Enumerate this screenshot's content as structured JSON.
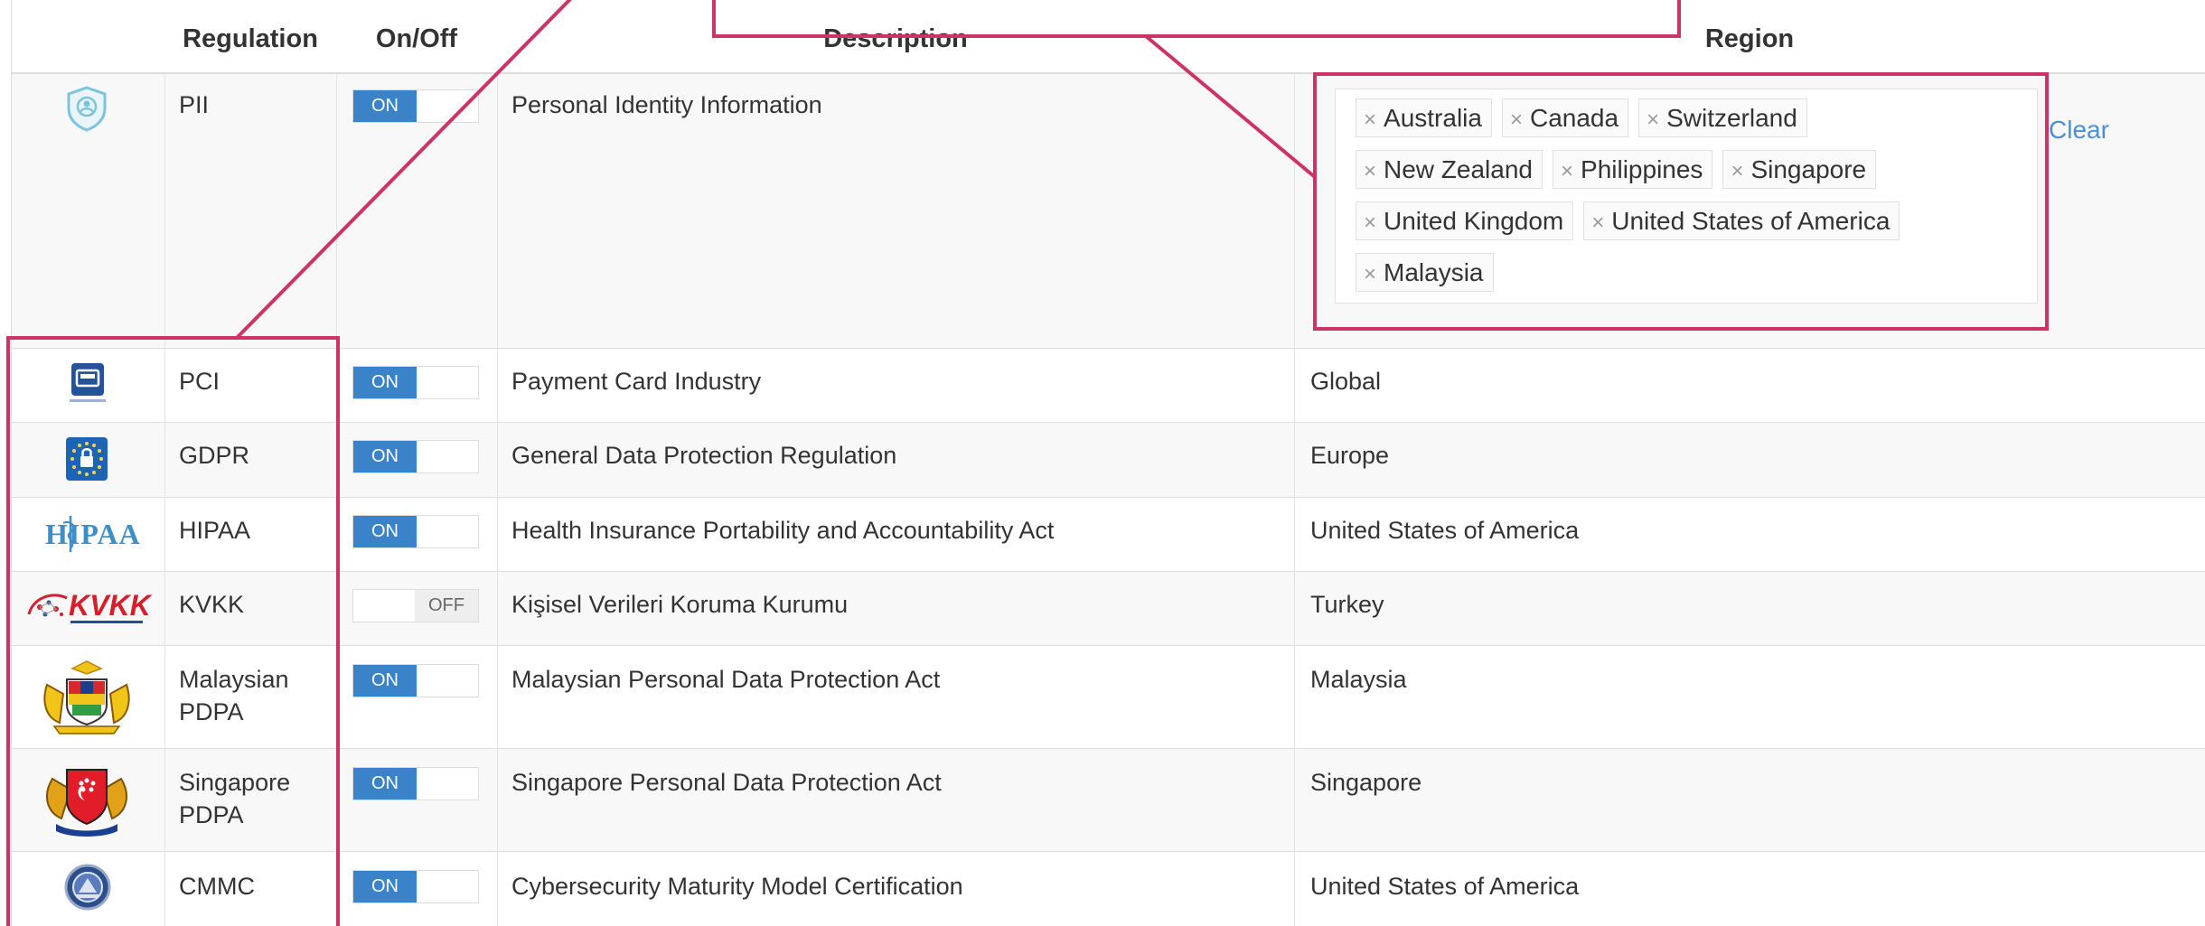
{
  "header": {
    "regulation": "Regulation",
    "onoff": "On/Off",
    "description": "Description",
    "region": "Region"
  },
  "rows": [
    {
      "name": "PII",
      "toggle": "ON",
      "description": "Personal Identity Information",
      "icon": "shield-user-icon"
    },
    {
      "name": "PCI",
      "toggle": "ON",
      "description": "Payment Card Industry",
      "region": "Global",
      "icon": "pci-compliance-icon"
    },
    {
      "name": "GDPR",
      "toggle": "ON",
      "description": "General Data Protection Regulation",
      "region": "Europe",
      "icon": "eu-lock-icon"
    },
    {
      "name": "HIPAA",
      "toggle": "ON",
      "description": "Health Insurance Portability and Accountability Act",
      "region": "United States of America",
      "icon": "hipaa-logo-icon",
      "logo_text": "HIPAA"
    },
    {
      "name": "KVKK",
      "toggle": "OFF",
      "description": "Kişisel Verileri Koruma Kurumu",
      "region": "Turkey",
      "icon": "kvkk-logo-icon",
      "logo_text": "KVKK"
    },
    {
      "name_line1": "Malaysian",
      "name_line2": "PDPA",
      "toggle": "ON",
      "description": "Malaysian Personal Data Protection Act",
      "region": "Malaysia",
      "icon": "malaysia-coat-of-arms-icon"
    },
    {
      "name_line1": "Singapore",
      "name_line2": "PDPA",
      "toggle": "ON",
      "description": "Singapore Personal Data Protection Act",
      "region": "Singapore",
      "icon": "singapore-coat-of-arms-icon"
    },
    {
      "name": "CMMC",
      "toggle": "ON",
      "description": "Cybersecurity Maturity Model Certification",
      "region": "United States of America",
      "icon": "cmmc-seal-icon"
    }
  ],
  "pii_region_tags": [
    "Australia",
    "Canada",
    "Switzerland",
    "New Zealand",
    "Philippines",
    "Singapore",
    "United Kingdom",
    "United States of America",
    "Malaysia"
  ],
  "clear_label": "Clear",
  "remove_glyph": "×",
  "colors": {
    "toggle_on": "#3a83c9",
    "annotation": "#cc3366",
    "link": "#4a90d9",
    "pii_row_bg": "#f8f8f8"
  }
}
